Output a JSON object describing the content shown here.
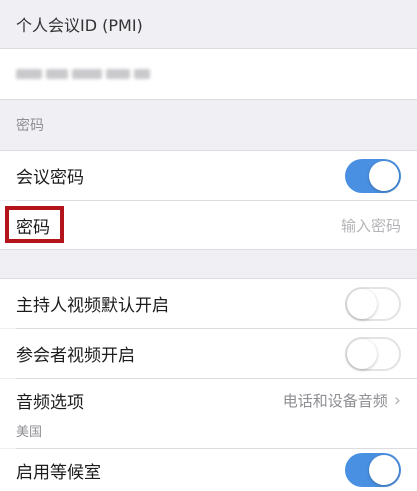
{
  "pmi_section": {
    "header": "个人会议ID (PMI)"
  },
  "password_section": {
    "header": "密码",
    "meeting_password_label": "会议密码",
    "meeting_password_enabled": true,
    "password_label": "密码",
    "password_placeholder": "输入密码"
  },
  "video_section": {
    "host_video_label": "主持人视频默认开启",
    "host_video_enabled": false,
    "participant_video_label": "参会者视频开启",
    "participant_video_enabled": false
  },
  "audio": {
    "label": "音频选项",
    "value": "电话和设备音频",
    "sub_value": "美国"
  },
  "waiting_room": {
    "label": "启用等候室",
    "enabled": true
  },
  "colors": {
    "accent": "#4a90e2",
    "highlight": "#b3141b",
    "background": "#efeff4"
  }
}
